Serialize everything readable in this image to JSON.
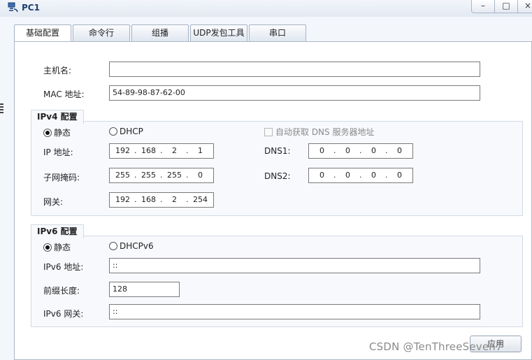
{
  "window": {
    "title": "PC1",
    "icon": "pc-network-icon",
    "controls": {
      "minimize": "–",
      "maximize": "□",
      "close": "×"
    }
  },
  "tabs": [
    {
      "label": "基础配置",
      "active": true
    },
    {
      "label": "命令行",
      "active": false
    },
    {
      "label": "组播",
      "active": false
    },
    {
      "label": "UDP发包工具",
      "active": false
    },
    {
      "label": "串口",
      "active": false
    }
  ],
  "basic": {
    "hostname_label": "主机名:",
    "hostname_value": "",
    "mac_label": "MAC 地址:",
    "mac_value": "54-89-98-87-62-00"
  },
  "ipv4": {
    "section_title": "IPv4 配置",
    "static_label": "静态",
    "dhcp_label": "DHCP",
    "mode_selected": "静态",
    "auto_dns_label": "自动获取 DNS 服务器地址",
    "auto_dns_checked": false,
    "ip_label": "IP 地址:",
    "ip": [
      "192",
      "168",
      "2",
      "1"
    ],
    "mask_label": "子网掩码:",
    "mask": [
      "255",
      "255",
      "255",
      "0"
    ],
    "gateway_label": "网关:",
    "gateway": [
      "192",
      "168",
      "2",
      "254"
    ],
    "dns1_label": "DNS1:",
    "dns1": [
      "0",
      "0",
      "0",
      "0"
    ],
    "dns2_label": "DNS2:",
    "dns2": [
      "0",
      "0",
      "0",
      "0"
    ]
  },
  "ipv6": {
    "section_title": "IPv6 配置",
    "static_label": "静态",
    "dhcp_label": "DHCPv6",
    "mode_selected": "静态",
    "address_label": "IPv6 地址:",
    "address_value": "::",
    "prefix_label": "前缀长度:",
    "prefix_value": "128",
    "gateway_label": "IPv6 网关:",
    "gateway_value": "::"
  },
  "actions": {
    "apply_label": "应用"
  },
  "watermark": "CSDN @TenThreeSeven7"
}
